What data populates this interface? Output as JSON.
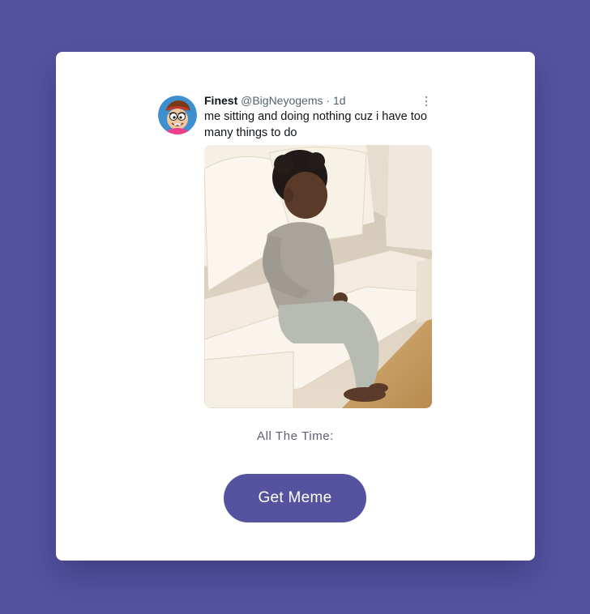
{
  "tweet": {
    "display_name": "Finest",
    "handle": "@BigNeyogems",
    "separator": "·",
    "time": "1d",
    "text": "me sitting and doing nothing cuz i have too many things to do",
    "avatar_icon": "cartoon-avatar-icon",
    "media_icon": "toddler-on-couch-image"
  },
  "caption": "All The Time:",
  "button": {
    "label": "Get Meme"
  },
  "colors": {
    "page_background": "#5553a0",
    "card": "#ffffff",
    "button": "#5553a0",
    "name": "#0f1419",
    "meta": "#536471"
  }
}
